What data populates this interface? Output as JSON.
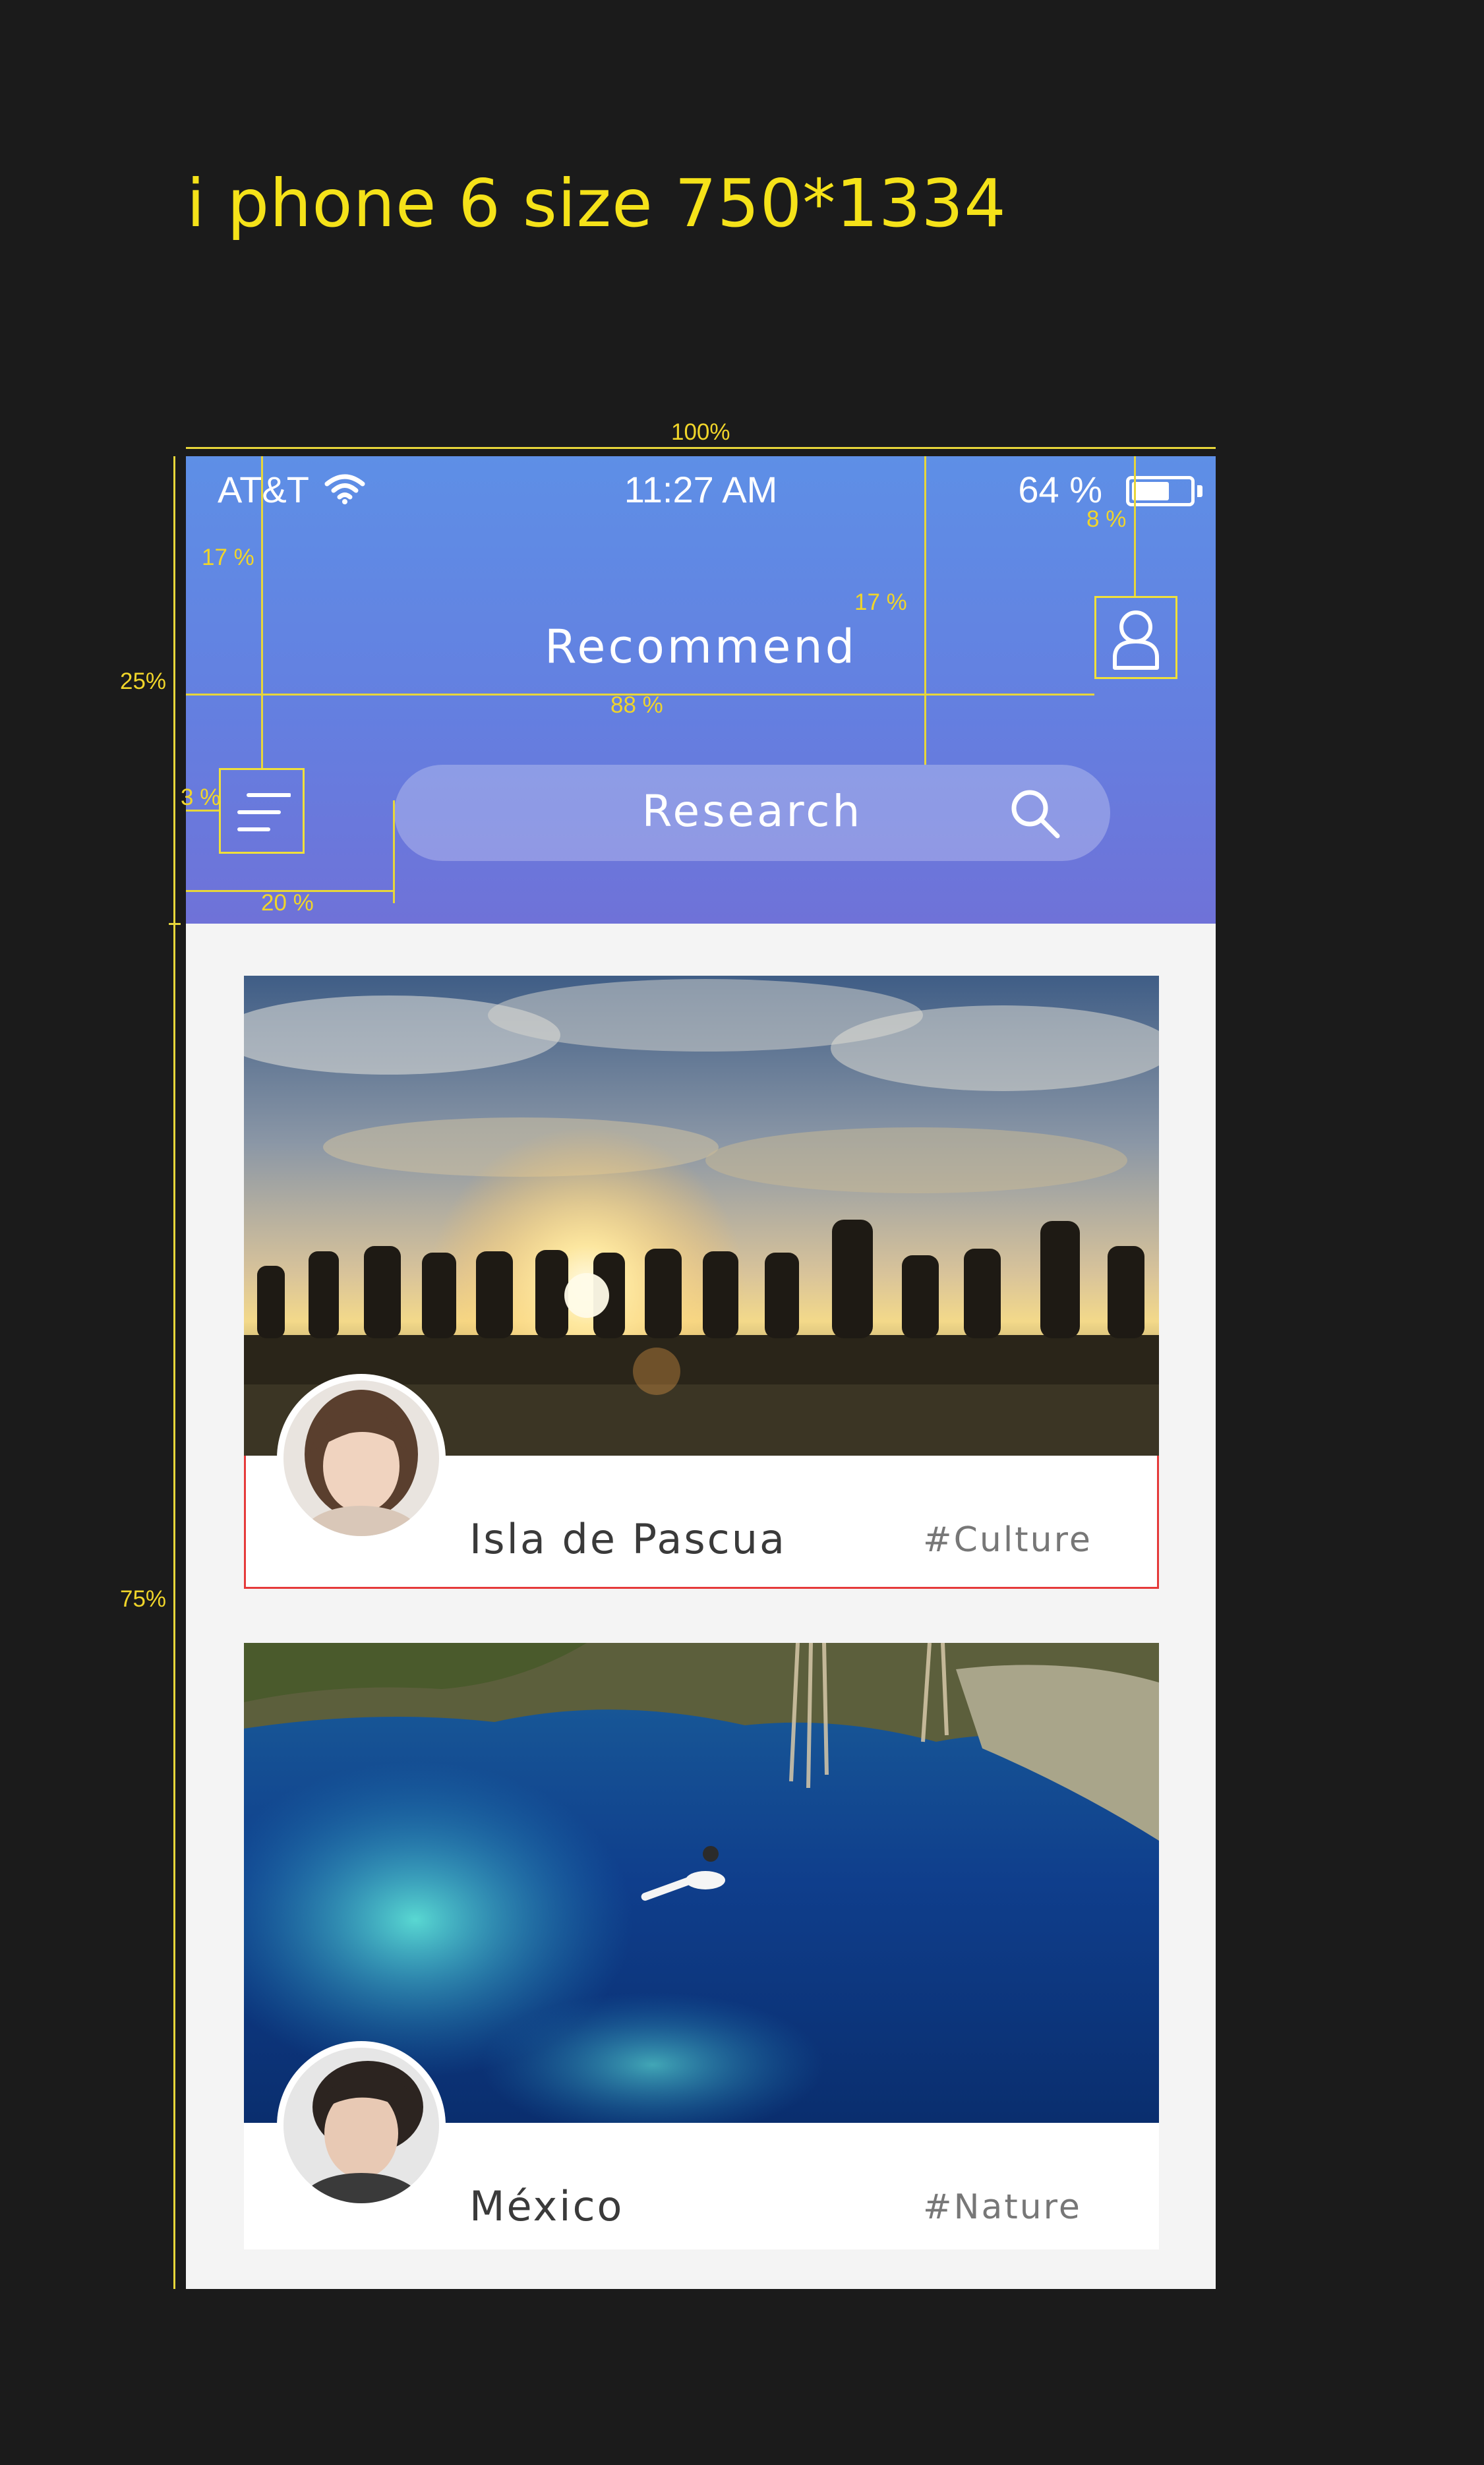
{
  "page": {
    "title": "i phone 6 size 750*1334"
  },
  "status_bar": {
    "carrier": "AT&T",
    "time": "11:27 AM",
    "battery_percent": "64 %",
    "battery_level": 0.64
  },
  "header": {
    "title": "Recommend"
  },
  "search": {
    "placeholder": "Research"
  },
  "cards": [
    {
      "place": "Isla de Pascua",
      "tag": "#Culture"
    },
    {
      "place": "México",
      "tag": "#Nature"
    }
  ],
  "guides": {
    "full_width": "100%",
    "header_height": "25%",
    "content_height": "75%",
    "menu_offset": "17 %",
    "search_offset": "17 %",
    "profile_width": "8 %",
    "title_span": "88 %",
    "menu_margin": "3 %",
    "search_left": "20 %"
  },
  "colors": {
    "background": "#1b1b1b",
    "header_top": "#5e8fe6",
    "header_bottom": "#6f72d8",
    "guide": "#f0d52a",
    "card_border": "#e53a3a"
  },
  "icons": [
    "wifi-icon",
    "battery-icon",
    "profile-icon",
    "menu-icon",
    "search-icon"
  ]
}
